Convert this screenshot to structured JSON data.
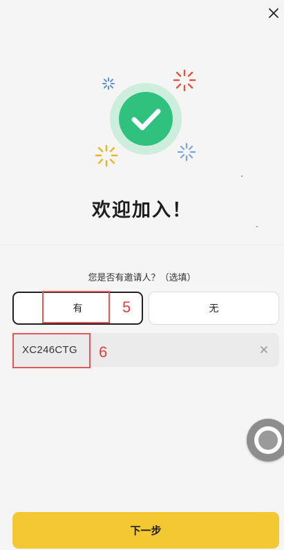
{
  "welcome": {
    "title": "欢迎加入！"
  },
  "invite": {
    "question": "您是否有邀请人？（选填）",
    "option_yes": "有",
    "option_no": "无",
    "selected": "有",
    "code_value": "XC246CTG"
  },
  "annotations": {
    "marker_yes": "5",
    "marker_code": "6"
  },
  "actions": {
    "next_label": "下一步"
  },
  "colors": {
    "accent_yellow": "#f3c832",
    "success_green": "#2ec27e",
    "annotation_red": "#e03e3e"
  }
}
